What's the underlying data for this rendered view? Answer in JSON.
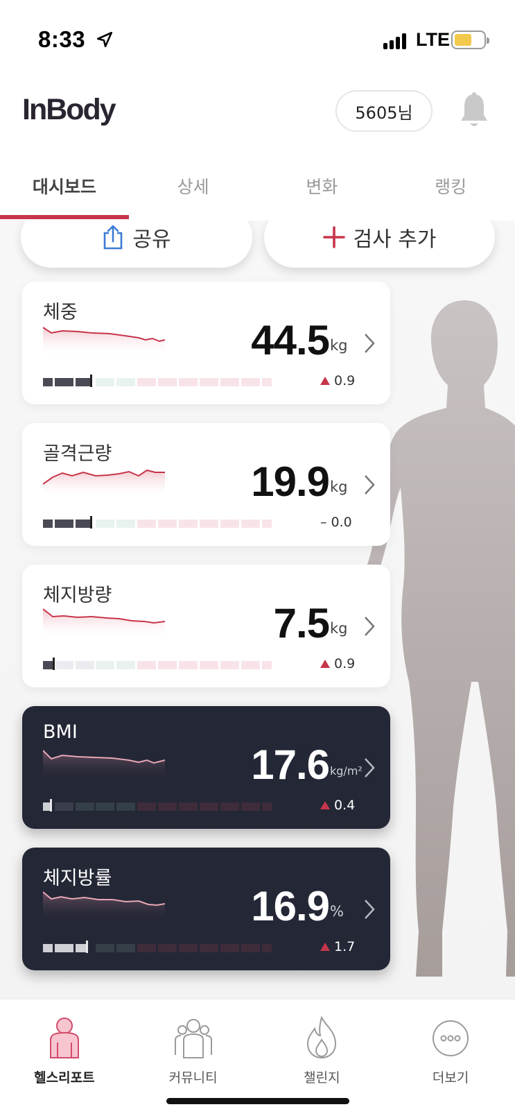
{
  "status": {
    "time": "8:33",
    "network": "LTE"
  },
  "header": {
    "logo": "InBody",
    "user": "5605님"
  },
  "tabs": [
    {
      "label": "대시보드",
      "active": true
    },
    {
      "label": "상세",
      "active": false
    },
    {
      "label": "변화",
      "active": false
    },
    {
      "label": "랭킹",
      "active": false
    }
  ],
  "actions": {
    "share": "공유",
    "add": "검사 추가"
  },
  "cards": [
    {
      "title": "체중",
      "value": "44.5",
      "unit": "kg",
      "delta": "0.9",
      "delta_dir": "up",
      "theme": "light",
      "accent": "#c7354a"
    },
    {
      "title": "골격근량",
      "value": "19.9",
      "unit": "kg",
      "delta": "– 0.0",
      "delta_dir": "none",
      "theme": "light",
      "accent": "#c7354a"
    },
    {
      "title": "체지방량",
      "value": "7.5",
      "unit": "kg",
      "delta": "0.9",
      "delta_dir": "up",
      "theme": "light",
      "accent": "#c7354a"
    },
    {
      "title": "BMI",
      "value": "17.6",
      "unit": "kg/m²",
      "delta": "0.4",
      "delta_dir": "up",
      "theme": "dark",
      "accent": "#e8a7b6"
    },
    {
      "title": "체지방률",
      "value": "16.9",
      "unit": "%",
      "delta": "1.7",
      "delta_dir": "up",
      "theme": "dark",
      "accent": "#e8a7b6"
    }
  ],
  "bottom_nav": [
    {
      "label": "헬스리포트",
      "icon": "health-report-icon",
      "active": true
    },
    {
      "label": "커뮤니티",
      "icon": "community-icon",
      "active": false
    },
    {
      "label": "챌린지",
      "icon": "flame-icon",
      "active": false
    },
    {
      "label": "더보기",
      "icon": "more-icon",
      "active": false
    }
  ]
}
